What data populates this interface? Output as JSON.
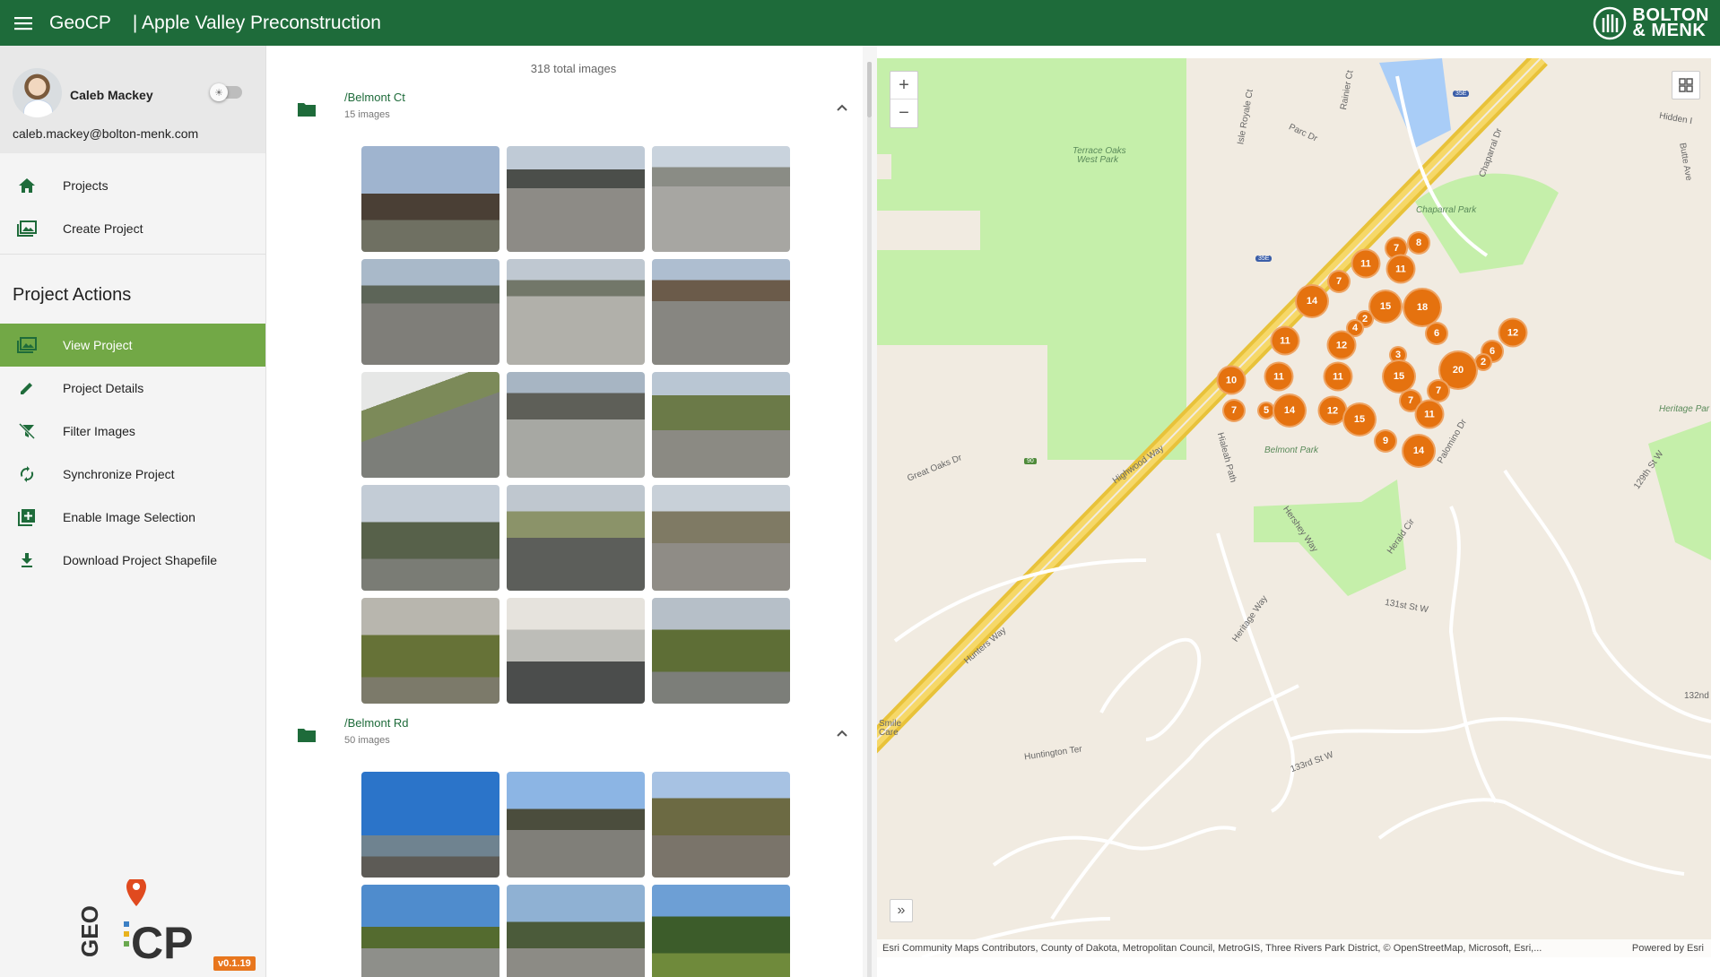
{
  "header": {
    "app_name": "GeoCP",
    "project_title": "| Apple Valley Preconstruction",
    "brand_line1": "BOLTON",
    "brand_line2": "& MENK"
  },
  "user": {
    "name": "Caleb Mackey",
    "email": "caleb.mackey@bolton-menk.com"
  },
  "nav": {
    "projects": "Projects",
    "create_project": "Create Project"
  },
  "project_actions": {
    "title": "Project Actions",
    "items": [
      {
        "label": "View Project",
        "icon": "image-icon"
      },
      {
        "label": "Project Details",
        "icon": "pencil-icon"
      },
      {
        "label": "Filter Images",
        "icon": "filter-off-icon"
      },
      {
        "label": "Synchronize Project",
        "icon": "sync-icon"
      },
      {
        "label": "Enable Image Selection",
        "icon": "add-box-icon"
      },
      {
        "label": "Download Project Shapefile",
        "icon": "download-icon"
      }
    ]
  },
  "version": "v0.1.19",
  "gallery": {
    "total": "318 total images",
    "folders": [
      {
        "name": "/Belmont Ct",
        "count": "15 images"
      },
      {
        "name": "/Belmont Rd",
        "count": "50 images"
      }
    ]
  },
  "map": {
    "zoom_in": "+",
    "zoom_out": "−",
    "attribution": "Esri Community Maps Contributors, County of Dakota, Metropolitan Council, MetroGIS, Three Rivers Park District, © OpenStreetMap, Microsoft, Esri,...",
    "powered_by": "Powered by Esri",
    "labels": {
      "terrace_oaks": "Terrace Oaks",
      "west_park": "West Park",
      "chaparral_park": "Chaparral Park",
      "belmont_park": "Belmont Park",
      "heritage_park": "Heritage Par",
      "great_oaks": "Great Oaks Dr",
      "highwood_way": "Highwood Way",
      "hialeah_path": "Hialeah Path",
      "hershey_way": "Hershey Way",
      "herald_cir": "Herald Cir",
      "palomino_dr": "Palomino Dr",
      "st_131": "131st St W",
      "st_133": "133rd St W",
      "st_132": "132nd C",
      "hunters_way": "Hunters Way",
      "heritage_way": "Heritage Way",
      "huntington_ter": "Huntington Ter",
      "isle_royale": "Isle Royale Ct",
      "parc_dr": "Parc Dr",
      "rainier_ct": "Rainier Ct",
      "chaparral_dr": "Chaparral Dr",
      "hidden": "Hidden I",
      "butte_ave": "Butte Ave",
      "st_129": "129th St W",
      "smile_care": "Smile Care",
      "route_35e": "35E",
      "route_90": "90"
    },
    "clusters": [
      "8",
      "7",
      "11",
      "11",
      "7",
      "14",
      "15",
      "18",
      "2",
      "4",
      "6",
      "11",
      "12",
      "12",
      "6",
      "2",
      "3",
      "10",
      "11",
      "11",
      "15",
      "20",
      "7",
      "7",
      "7",
      "5",
      "14",
      "12",
      "15",
      "9",
      "11",
      "14"
    ]
  }
}
